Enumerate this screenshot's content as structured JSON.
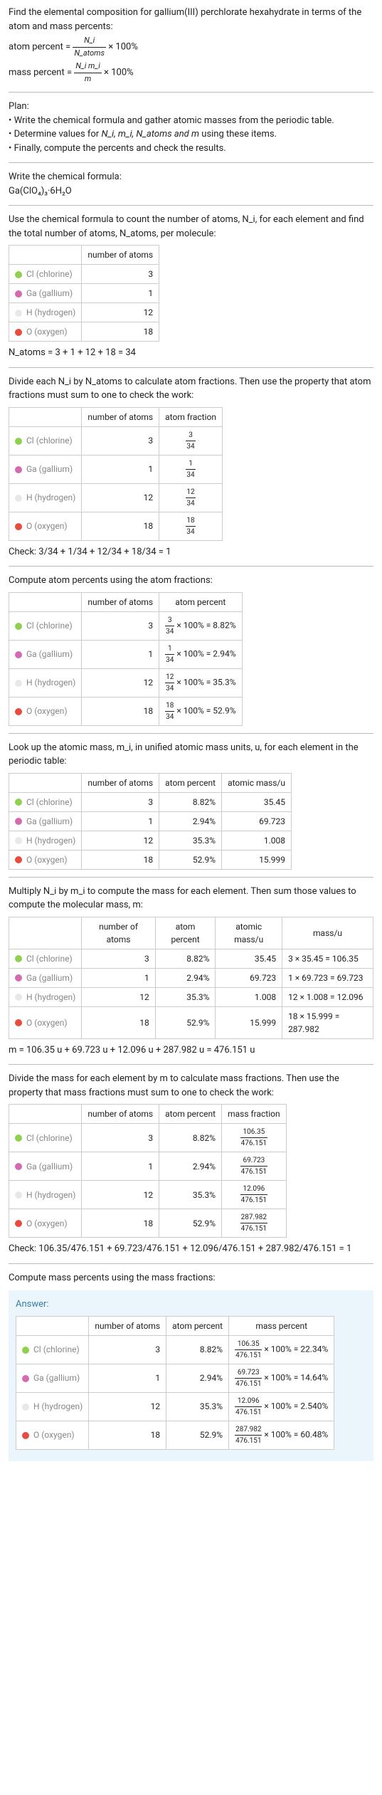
{
  "intro": {
    "title": "Find the elemental composition for gallium(III) perchlorate hexahydrate in terms of the atom and mass percents:",
    "atom_label": "atom percent =",
    "atom_frac_num": "N_i",
    "atom_frac_den": "N_atoms",
    "times100": "× 100%",
    "mass_label": "mass percent =",
    "mass_frac_num": "N_i m_i",
    "mass_frac_den": "m"
  },
  "plan": {
    "heading": "Plan:",
    "b1": "• Write the chemical formula and gather atomic masses from the periodic table.",
    "b2_pre": "• Determine values for ",
    "b2_vars": "N_i, m_i, N_atoms and m",
    "b2_post": " using these items.",
    "b3": "• Finally, compute the percents and check the results."
  },
  "writeFormula": {
    "heading": "Write the chemical formula:",
    "formula": "Ga(ClO₄)₃·6H₂O"
  },
  "countAtoms": {
    "p": "Use the chemical formula to count the number of atoms, N_i, for each element and find the total number of atoms, N_atoms, per molecule:",
    "col_atoms": "number of atoms",
    "total": "N_atoms = 3 + 1 + 12 + 18 = 34"
  },
  "elements": [
    {
      "color": "#8fd14f",
      "label": "Cl (chlorine)",
      "n": "3",
      "af_num": "3",
      "af_den": "34",
      "ap": "8.82%",
      "ap_expr": "3/34 × 100% = 8.82%",
      "mass": "35.45",
      "massu": "3 × 35.45 = 106.35",
      "mf_num": "106.35",
      "mf_den": "476.151",
      "mp": "106.35/476.151 × 100% = 22.34%"
    },
    {
      "color": "#d46bb0",
      "label": "Ga (gallium)",
      "n": "1",
      "af_num": "1",
      "af_den": "34",
      "ap": "2.94%",
      "ap_expr": "1/34 × 100% = 2.94%",
      "mass": "69.723",
      "massu": "1 × 69.723 = 69.723",
      "mf_num": "69.723",
      "mf_den": "476.151",
      "mp": "69.723/476.151 × 100% = 14.64%"
    },
    {
      "color": "#e8e8e8",
      "label": "H (hydrogen)",
      "n": "12",
      "af_num": "12",
      "af_den": "34",
      "ap": "35.3%",
      "ap_expr": "12/34 × 100% = 35.3%",
      "mass": "1.008",
      "massu": "12 × 1.008 = 12.096",
      "mf_num": "12.096",
      "mf_den": "476.151",
      "mp": "12.096/476.151 × 100% = 2.540%"
    },
    {
      "color": "#e74c3c",
      "label": "O (oxygen)",
      "n": "18",
      "af_num": "18",
      "af_den": "34",
      "ap": "52.9%",
      "ap_expr": "18/34 × 100% = 52.9%",
      "mass": "15.999",
      "massu": "18 × 15.999 = 287.982",
      "mf_num": "287.982",
      "mf_den": "476.151",
      "mp": "287.982/476.151 × 100% = 60.48%"
    }
  ],
  "atomFractions": {
    "p": "Divide each N_i by N_atoms to calculate atom fractions. Then use the property that atom fractions must sum to one to check the work:",
    "col_atoms": "number of atoms",
    "col_frac": "atom fraction",
    "check": "Check: 3/34 + 1/34 + 12/34 + 18/34 = 1"
  },
  "atomPercents": {
    "p": "Compute atom percents using the atom fractions:",
    "col_atoms": "number of atoms",
    "col_ap": "atom percent"
  },
  "lookup": {
    "p": "Look up the atomic mass, m_i, in unified atomic mass units, u, for each element in the periodic table:",
    "col_atoms": "number of atoms",
    "col_ap": "atom percent",
    "col_mass": "atomic mass/u"
  },
  "multiply": {
    "p": "Multiply N_i by m_i to compute the mass for each element. Then sum those values to compute the molecular mass, m:",
    "col_atoms": "number of atoms",
    "col_ap": "atom percent",
    "col_mass": "atomic mass/u",
    "col_massu": "mass/u",
    "total": "m = 106.35 u + 69.723 u + 12.096 u + 287.982 u = 476.151 u"
  },
  "massFractions": {
    "p": "Divide the mass for each element by m to calculate mass fractions. Then use the property that mass fractions must sum to one to check the work:",
    "col_atoms": "number of atoms",
    "col_ap": "atom percent",
    "col_mf": "mass fraction",
    "check": "Check: 106.35/476.151 + 69.723/476.151 + 12.096/476.151 + 287.982/476.151 = 1"
  },
  "massPercents": {
    "p": "Compute mass percents using the mass fractions:"
  },
  "answer": {
    "label": "Answer:",
    "col_atoms": "number of atoms",
    "col_ap": "atom percent",
    "col_mp": "mass percent"
  }
}
